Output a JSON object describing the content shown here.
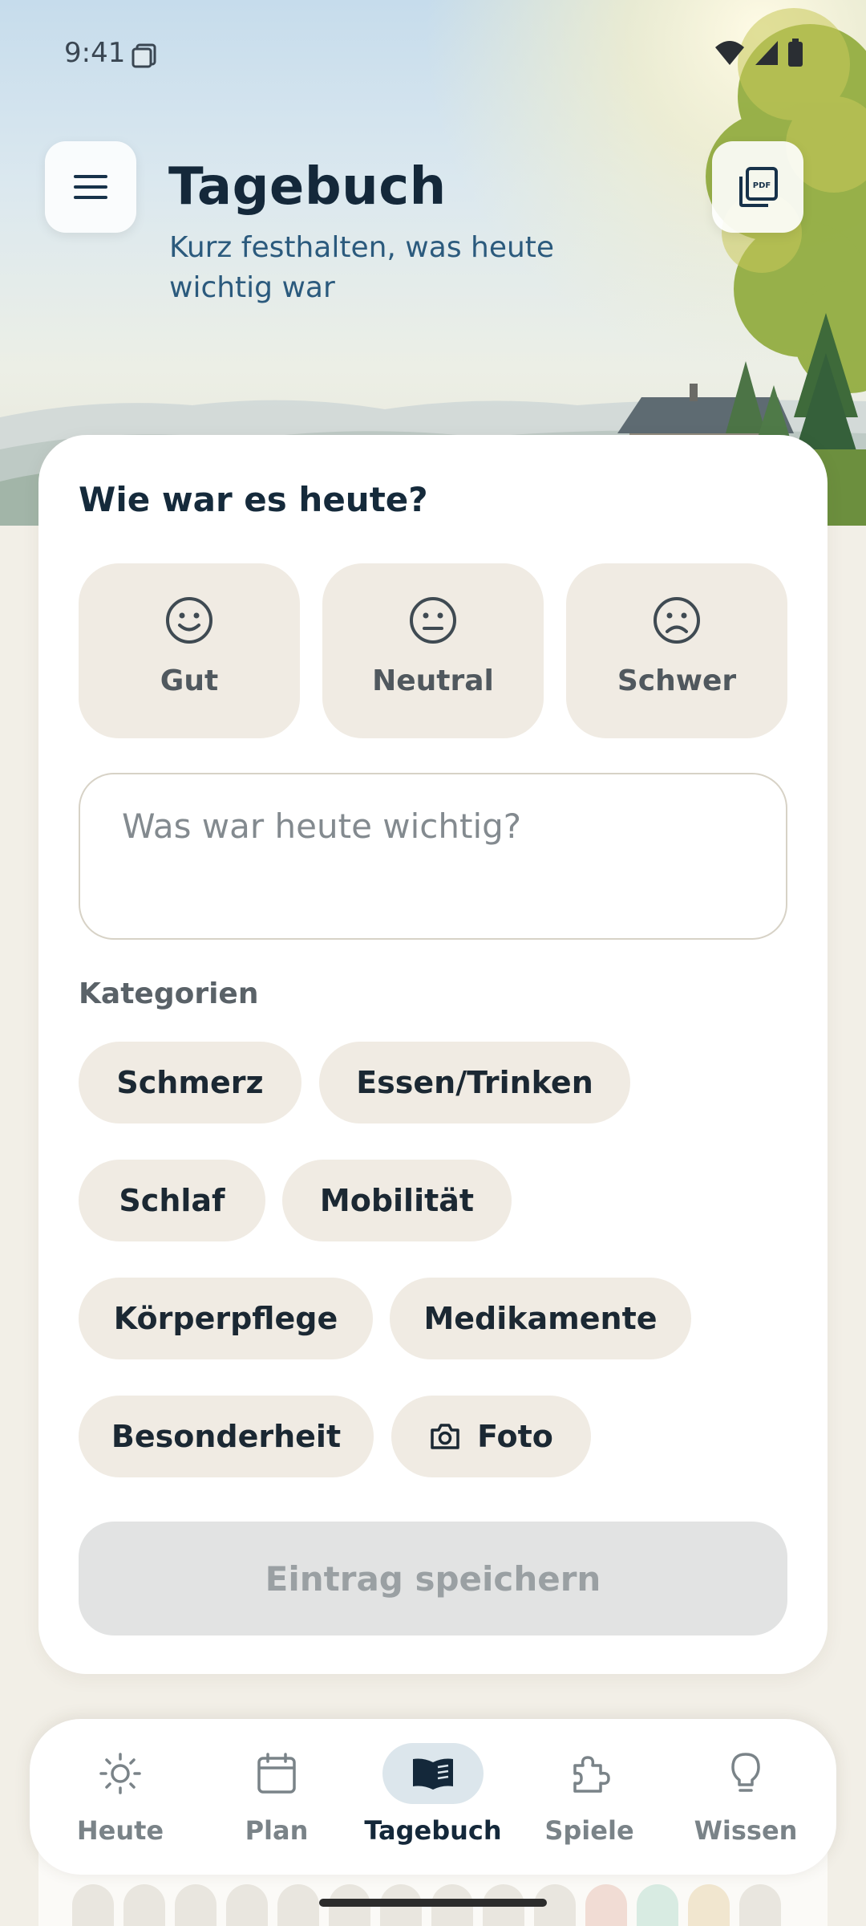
{
  "status_bar": {
    "time": "9:41"
  },
  "header": {
    "title": "Tagebuch",
    "subtitle": "Kurz festhalten, was heute wichtig war"
  },
  "mood": {
    "heading": "Wie war es heute?",
    "options": [
      {
        "label": "Gut",
        "icon": "smile-icon"
      },
      {
        "label": "Neutral",
        "icon": "neutral-face-icon"
      },
      {
        "label": "Schwer",
        "icon": "sad-face-icon"
      }
    ]
  },
  "note": {
    "placeholder": "Was war heute wichtig?"
  },
  "categories": {
    "label": "Kategorien",
    "chips": [
      "Schmerz",
      "Essen/Trinken",
      "Schlaf",
      "Mobilität",
      "Körperpflege",
      "Medikamente",
      "Besonderheit",
      "Foto"
    ]
  },
  "save_button": {
    "label": "Eintrag speichern"
  },
  "bottom_nav": {
    "items": [
      {
        "label": "Heute",
        "icon": "sun-icon",
        "active": false
      },
      {
        "label": "Plan",
        "icon": "calendar-icon",
        "active": false
      },
      {
        "label": "Tagebuch",
        "icon": "book-icon",
        "active": true
      },
      {
        "label": "Spiele",
        "icon": "puzzle-icon",
        "active": false
      },
      {
        "label": "Wissen",
        "icon": "lightbulb-icon",
        "active": false
      }
    ]
  },
  "colors": {
    "background": "#f2efe7",
    "card": "#ffffff",
    "chip": "#f0ebe3",
    "title": "#14283a",
    "subtitle": "#2b5a7d",
    "nav_active_bg": "#dce6ec"
  }
}
